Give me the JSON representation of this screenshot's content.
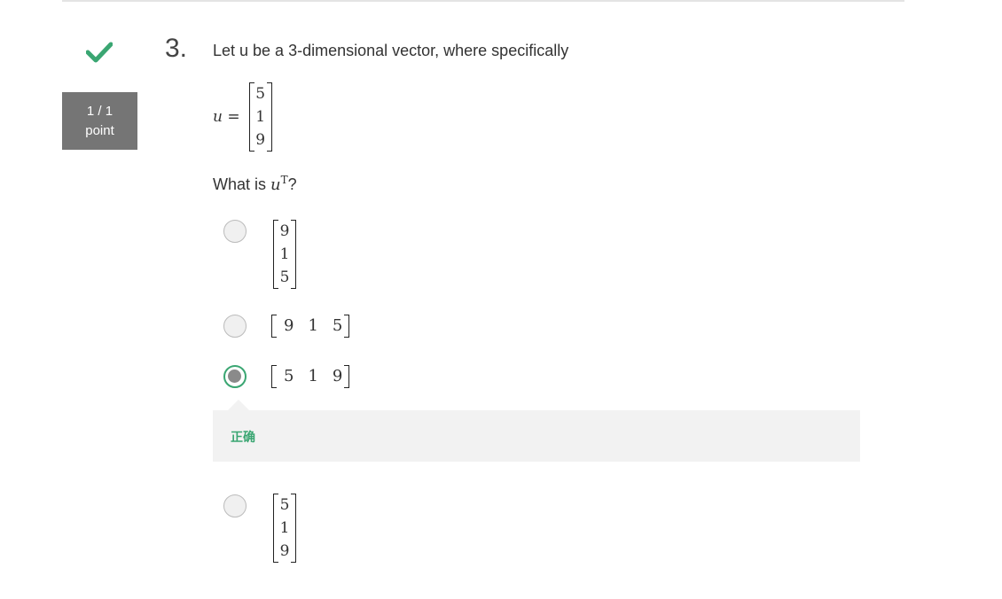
{
  "status": {
    "icon": "checkmark-icon",
    "color": "#3aa672"
  },
  "score": {
    "value": "1 / 1",
    "unit": "point"
  },
  "question": {
    "number": "3.",
    "text": "Let u be a 3-dimensional vector, where specifically",
    "equation_lhs": "u =",
    "vector": [
      "5",
      "1",
      "9"
    ],
    "prompt_prefix": "What is ",
    "prompt_var": "u",
    "prompt_sup": "T",
    "prompt_suffix": "?"
  },
  "options": [
    {
      "type": "column",
      "values": [
        "9",
        "1",
        "5"
      ],
      "selected": false
    },
    {
      "type": "row",
      "values": [
        "9",
        "1",
        "5"
      ],
      "selected": false
    },
    {
      "type": "row",
      "values": [
        "5",
        "1",
        "9"
      ],
      "selected": true
    },
    {
      "type": "column",
      "values": [
        "5",
        "1",
        "9"
      ],
      "selected": false
    }
  ],
  "feedback": {
    "text": "正确",
    "color": "#3aa672"
  }
}
